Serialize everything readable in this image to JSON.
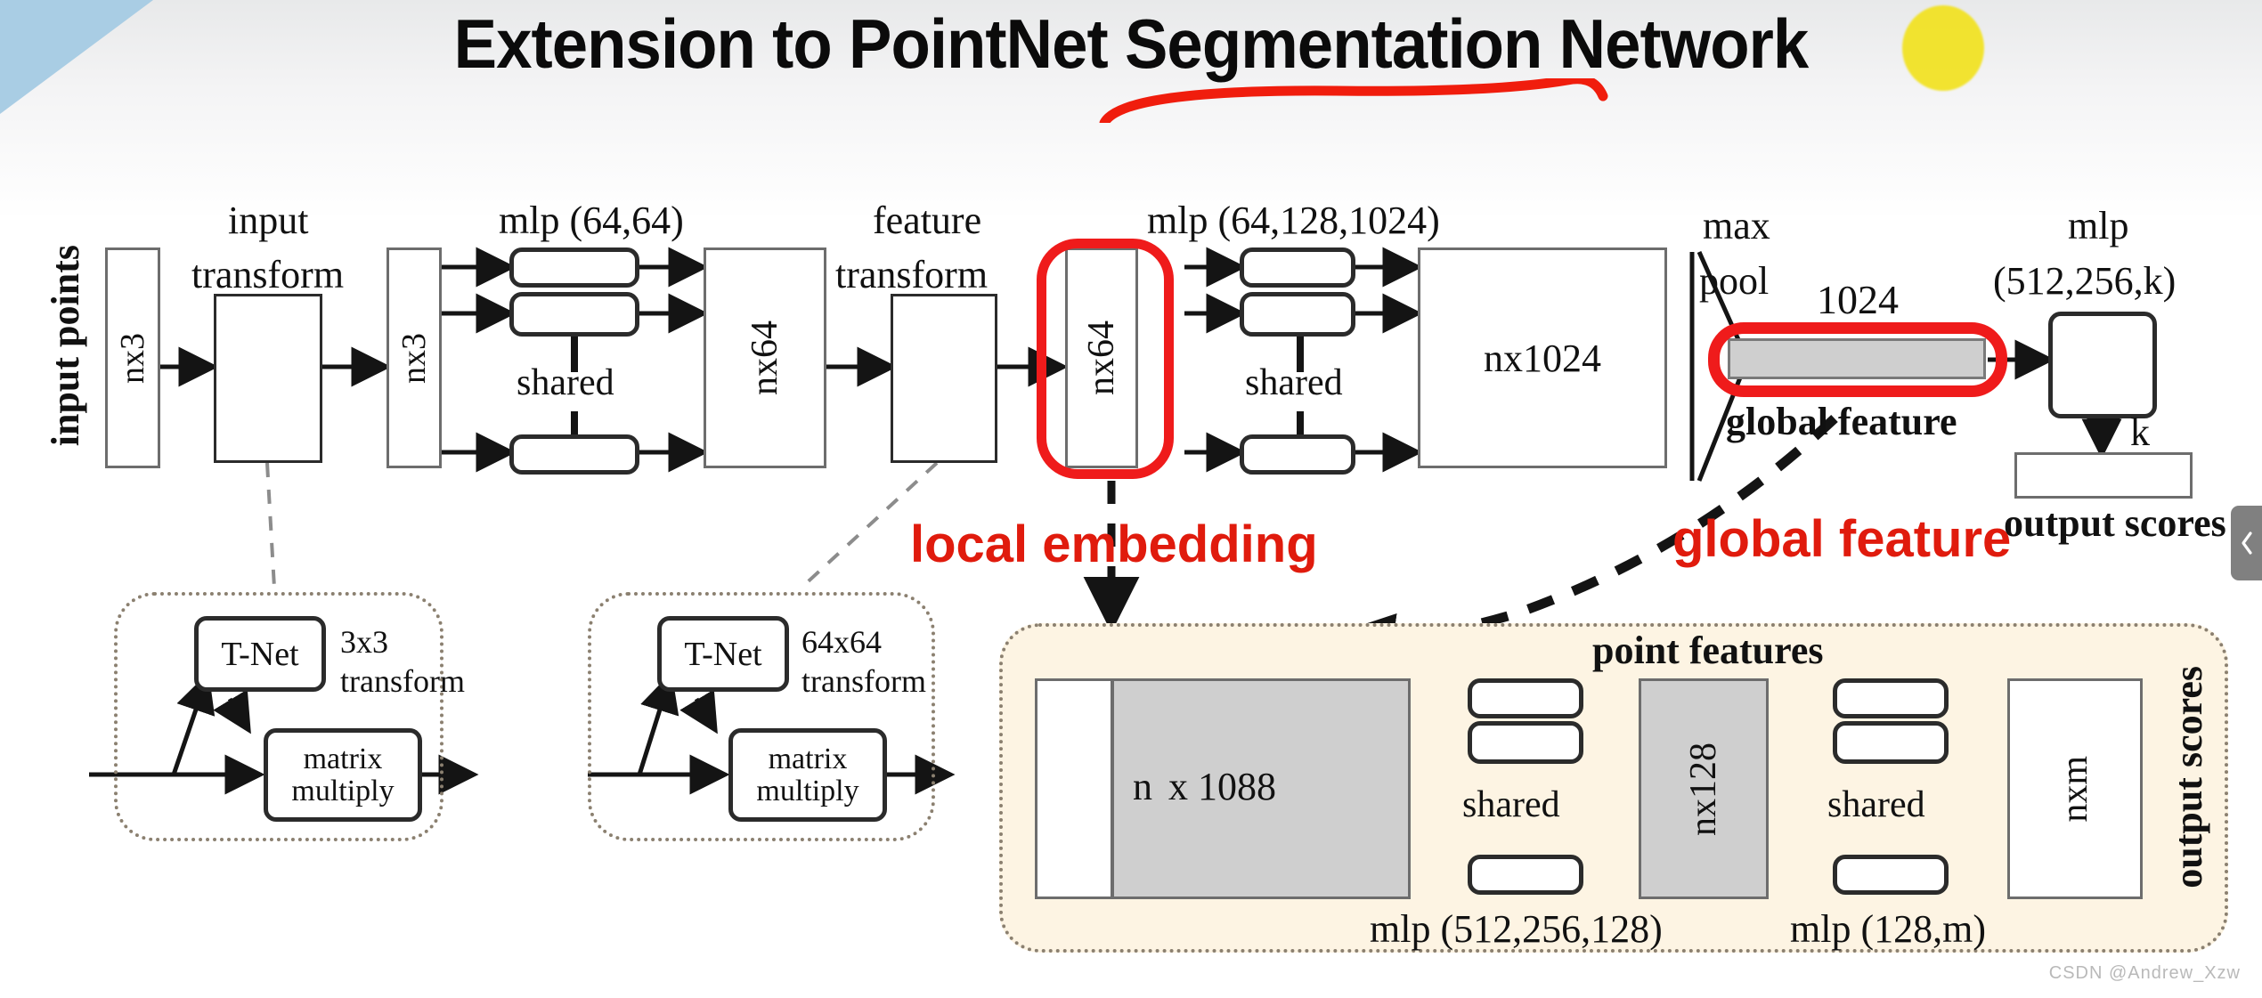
{
  "slide": {
    "title": "Extension to PointNet Segmentation Network",
    "watermark": "CSDN @Andrew_Xzw",
    "accent_red": "#e01b0d",
    "highlight_yellow": "#f2e21b",
    "panel_cream": "#fdf4e3",
    "gray_fill": "#cfcfcf"
  },
  "classification_branch": {
    "input_label": "input points",
    "blocks": [
      {
        "name": "input-points-nx3",
        "text": "nx3"
      },
      {
        "name": "input-transform",
        "text": ""
      },
      {
        "name": "transformed-nx3",
        "text": "nx3"
      },
      {
        "name": "nx64-after-mlp",
        "text": "nx64"
      },
      {
        "name": "feature-transform",
        "text": ""
      },
      {
        "name": "local-embedding-nx64",
        "text": "nx64"
      },
      {
        "name": "nx1024",
        "text": "nx1024"
      },
      {
        "name": "global-feature-bar",
        "text": ""
      },
      {
        "name": "classification-mlp",
        "text": ""
      },
      {
        "name": "output-scores-bar",
        "text": ""
      }
    ],
    "captions": {
      "input_transform": [
        "input",
        "transform"
      ],
      "mlp_64_64": "mlp (64,64)",
      "shared_1": "shared",
      "feature_transform": [
        "feature",
        "transform"
      ],
      "mlp_64_128_1024": "mlp (64,128,1024)",
      "shared_2": "shared",
      "max_pool": [
        "max",
        "pool"
      ],
      "global_dim": "1024",
      "global_feature": "global feature",
      "mlp_512_256_k": [
        "mlp",
        "(512,256,k)"
      ],
      "k_arrow": "k",
      "output_scores": "output scores"
    }
  },
  "tnet_boxes": [
    {
      "name": "input-tnet",
      "tnet_label": "T-Net",
      "transform_label": [
        "3x3",
        "transform"
      ],
      "matmul_label": [
        "matrix",
        "multiply"
      ]
    },
    {
      "name": "feature-tnet",
      "tnet_label": "T-Net",
      "transform_label": [
        "64x64",
        "transform"
      ],
      "matmul_label": [
        "matrix",
        "multiply"
      ]
    }
  ],
  "segmentation_panel": {
    "title": "point features",
    "concat_block": {
      "n": "n",
      "dims": "x 1088"
    },
    "mlp_1": "mlp (512,256,128)",
    "shared_1": "shared",
    "nx128": "nx128",
    "mlp_2": "mlp (128,m)",
    "shared_2": "shared",
    "nxm": "nxm",
    "output_scores": "output scores"
  },
  "annotations": {
    "local_embedding": "local embedding",
    "global_feature": "global feature"
  },
  "side_panel_toggle": {
    "icon": "chevron-left-icon"
  }
}
